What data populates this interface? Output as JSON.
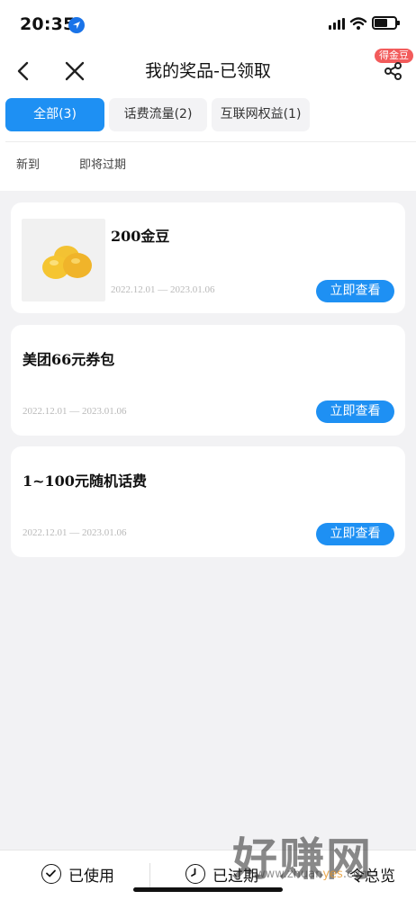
{
  "status_bar": {
    "time": "20:35"
  },
  "navbar": {
    "title": "我的奖品-已领取",
    "badge": "得金豆"
  },
  "tabs": [
    {
      "label": "全部(3)",
      "active": true
    },
    {
      "label": "话费流量(2)",
      "active": false
    },
    {
      "label": "互联网权益(1)",
      "active": false
    }
  ],
  "filters": [
    "新到",
    "即将过期"
  ],
  "prizes": [
    {
      "title": "200金豆",
      "date": "2022.12.01 — 2023.01.06",
      "button": "立即查看",
      "has_image": true
    },
    {
      "title": "美团66元券包",
      "date": "2022.12.01 — 2023.01.06",
      "button": "立即查看",
      "has_image": false
    },
    {
      "title": "1~100元随机话费",
      "date": "2022.12.01 — 2023.01.06",
      "button": "立即查看",
      "has_image": false
    }
  ],
  "bottom_bar": {
    "used_label": "已使用",
    "expired_label": "已过期",
    "third_label": "令总览"
  },
  "watermark": {
    "text": "好赚网",
    "url_prefix": "www.zhuan",
    "url_highlight": "yes",
    "url_suffix": ".com"
  },
  "colors": {
    "accent": "#1e90f3",
    "badge": "#f25b5b",
    "background": "#f2f2f4"
  }
}
